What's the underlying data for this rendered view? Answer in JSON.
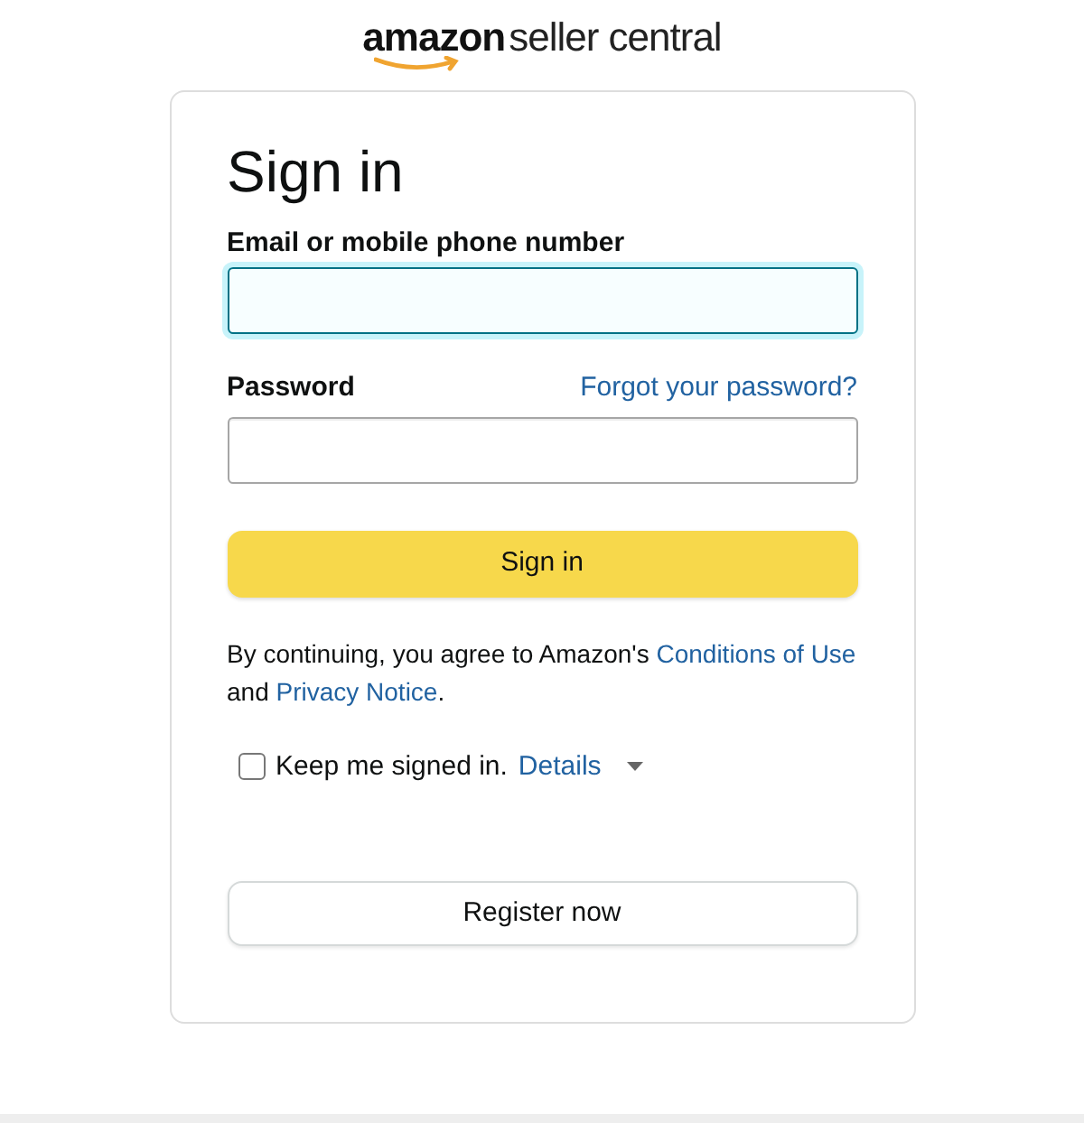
{
  "logo": {
    "brand": "amazon",
    "product": "seller central"
  },
  "card": {
    "title": "Sign in",
    "email": {
      "label": "Email or mobile phone number",
      "focused": true
    },
    "password": {
      "label": "Password",
      "forgot_link": "Forgot your password?",
      "focused": false
    },
    "sign_in_button": "Sign in",
    "legal": {
      "before": "By continuing, you agree to Amazon's ",
      "link_1": "Conditions of Use",
      "middle": " and ",
      "link_2": "Privacy Notice",
      "after": "."
    },
    "keep_signed_in": {
      "label": "Keep me signed in.",
      "checked": false,
      "details_link": "Details"
    },
    "register_button": "Register now"
  }
}
